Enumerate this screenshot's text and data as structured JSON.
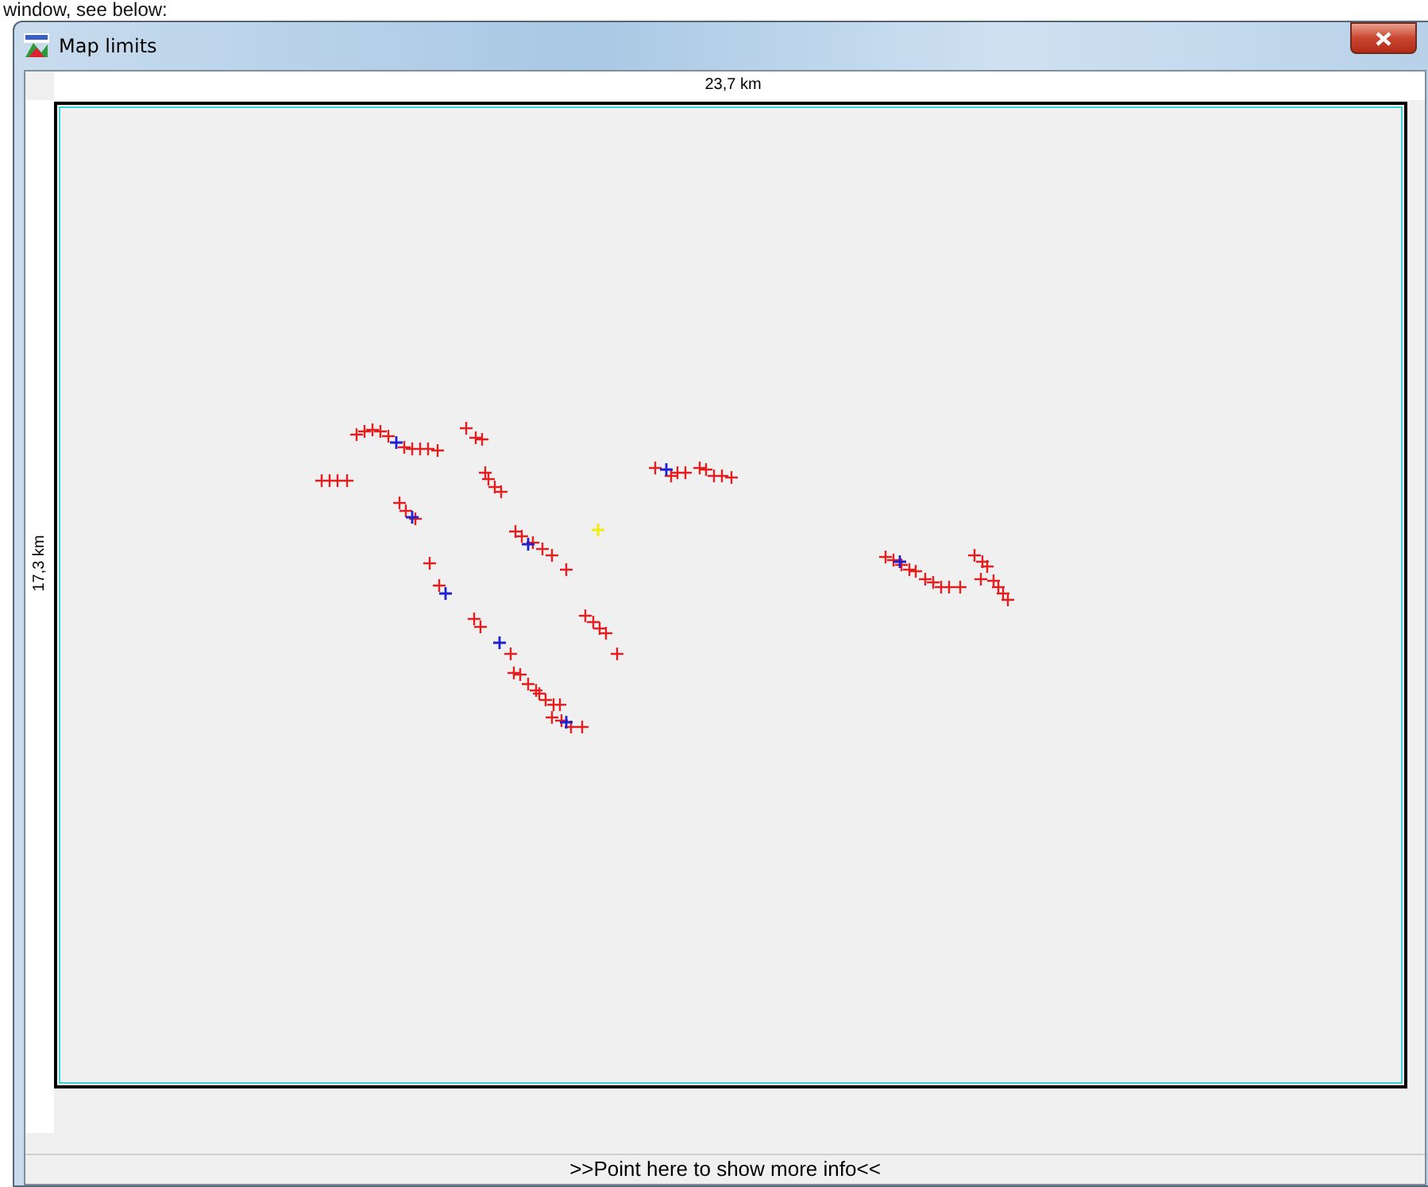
{
  "document_text": "window, see below:",
  "window": {
    "title": "Map limits"
  },
  "map": {
    "width_label": "23,7 km",
    "height_label": "17,3 km"
  },
  "status_bar": {
    "text": ">>Point here to show more info<<"
  }
}
